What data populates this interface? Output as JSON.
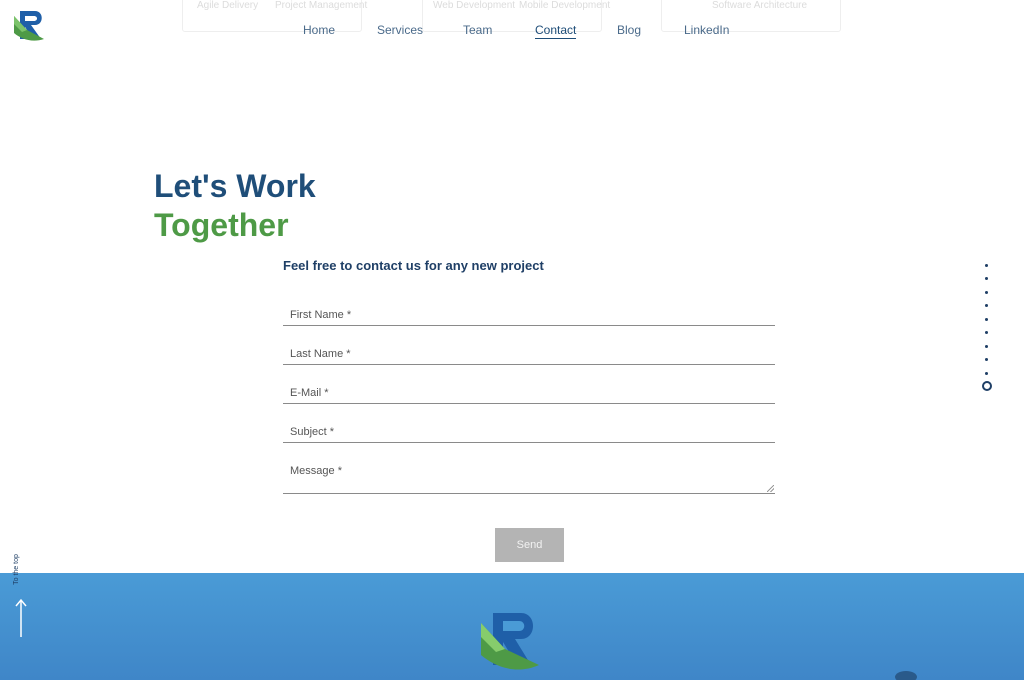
{
  "nav": {
    "items": [
      {
        "label": "Home"
      },
      {
        "label": "Services"
      },
      {
        "label": "Team"
      },
      {
        "label": "Contact",
        "active": true
      },
      {
        "label": "Blog"
      },
      {
        "label": "LinkedIn"
      }
    ]
  },
  "background_cards": [
    [
      "Agile Delivery",
      "Project Management"
    ],
    [
      "Web Development",
      "Mobile Development"
    ],
    [
      "Software Architecture"
    ]
  ],
  "hero": {
    "line1": "Let's Work",
    "line2": "Together"
  },
  "form": {
    "subtitle": "Feel free to contact us for any new project",
    "fields": [
      {
        "placeholder": "First Name *"
      },
      {
        "placeholder": "Last Name *"
      },
      {
        "placeholder": "E-Mail *"
      },
      {
        "placeholder": "Subject *"
      },
      {
        "placeholder": "Message *"
      }
    ],
    "send_label": "Send"
  },
  "pager": {
    "count": 10,
    "active_index": 9
  },
  "to_top": {
    "label": "To the top"
  },
  "colors": {
    "heading_blue": "#1f4e79",
    "heading_green": "#4e9a46",
    "footer_blue": "#4a9bd6",
    "button_gray": "#b4b4b4"
  },
  "icons": {
    "logo": "r-logo-icon",
    "arrow": "arrow-up-icon",
    "chat": "chat-bubble-icon"
  }
}
